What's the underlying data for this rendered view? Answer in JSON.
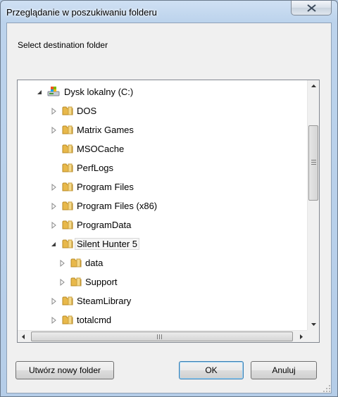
{
  "window": {
    "title": "Przeglądanie w poszukiwaniu folderu"
  },
  "dialog": {
    "instruction": "Select destination folder"
  },
  "tree": {
    "items": [
      {
        "label": "Dysk lokalny (C:)",
        "icon": "drive-icon",
        "expanded": true
      },
      {
        "label": "DOS",
        "icon": "folder-icon"
      },
      {
        "label": "Matrix Games",
        "icon": "folder-icon"
      },
      {
        "label": "MSOCache",
        "icon": "folder-icon"
      },
      {
        "label": "PerfLogs",
        "icon": "folder-icon"
      },
      {
        "label": "Program Files",
        "icon": "folder-icon"
      },
      {
        "label": "Program Files (x86)",
        "icon": "folder-icon"
      },
      {
        "label": "ProgramData",
        "icon": "folder-icon"
      },
      {
        "label": "Silent Hunter 5",
        "icon": "folder-icon",
        "expanded": true,
        "selected": true
      },
      {
        "label": "data",
        "icon": "folder-icon"
      },
      {
        "label": "Support",
        "icon": "folder-icon"
      },
      {
        "label": "SteamLibrary",
        "icon": "folder-icon"
      },
      {
        "label": "totalcmd",
        "icon": "folder-icon"
      }
    ]
  },
  "buttons": {
    "new_folder": "Utwórz nowy folder",
    "ok": "OK",
    "cancel": "Anuluj"
  },
  "colors": {
    "folder": "#e8b84a",
    "selection_border": "#d9d9d9"
  }
}
